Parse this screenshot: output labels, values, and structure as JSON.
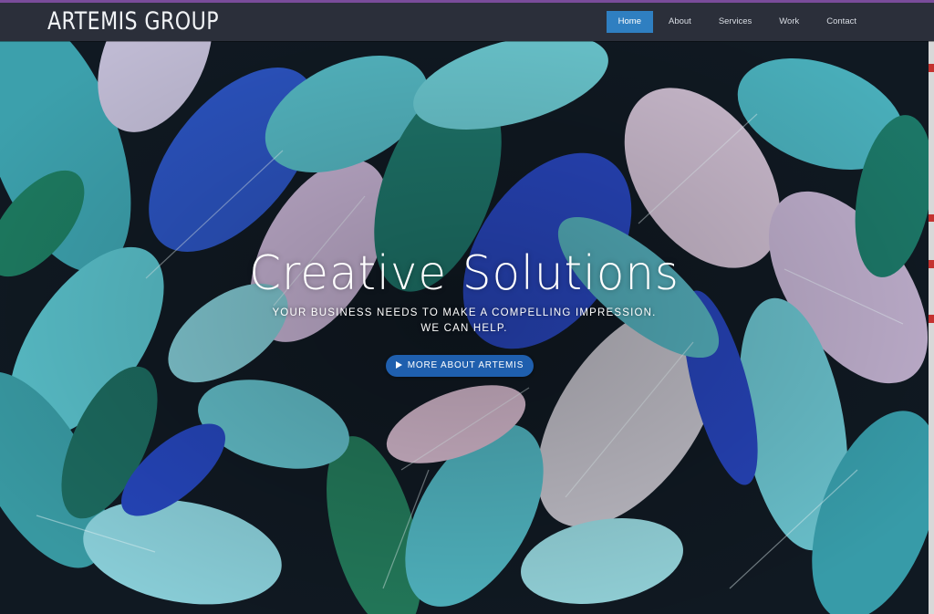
{
  "site": {
    "logo": "ARTEMIS GROUP"
  },
  "nav": {
    "items": [
      {
        "label": "Home",
        "active": true
      },
      {
        "label": "About"
      },
      {
        "label": "Services"
      },
      {
        "label": "Work"
      },
      {
        "label": "Contact"
      }
    ]
  },
  "hero": {
    "headline": "Creative Solutions",
    "tagline_1": "YOUR BUSINESS NEEDS TO MAKE A COMPELLING IMPRESSION.",
    "tagline_2": "WE CAN HELP.",
    "cta_label": "MORE ABOUT ARTEMIS",
    "cta_icon": "play-icon"
  },
  "colors": {
    "accent": "#2f7fc1",
    "cta": "#1f5fae",
    "navbar": "#2b2f3a",
    "top_line": "#7a4c9a"
  }
}
